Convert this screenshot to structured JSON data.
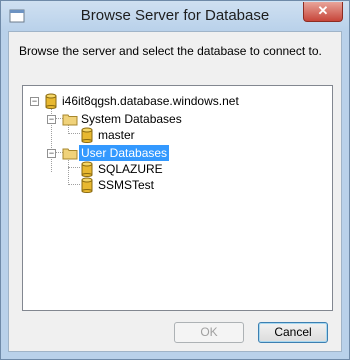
{
  "window": {
    "title": "Browse Server for Database",
    "close_glyph": "✕"
  },
  "instructions": "Browse the server and select the database to connect to.",
  "tree": {
    "server": {
      "label": "i46it8qgsh.database.windows.net",
      "expander": "−",
      "icon": "database-icon"
    },
    "system_databases": {
      "label": "System Databases",
      "expander": "−",
      "icon": "folder-icon",
      "children": [
        {
          "label": "master",
          "icon": "database-icon"
        }
      ]
    },
    "user_databases": {
      "label": "User Databases",
      "expander": "−",
      "icon": "folder-icon",
      "selected": true,
      "children": [
        {
          "label": "SQLAZURE",
          "icon": "database-icon"
        },
        {
          "label": "SSMSTest",
          "icon": "database-icon"
        }
      ]
    }
  },
  "buttons": {
    "ok": {
      "label": "OK",
      "enabled": false
    },
    "cancel": {
      "label": "Cancel",
      "enabled": true
    }
  },
  "colors": {
    "selection": "#3399ff",
    "frame": "#b9d1ea",
    "close_button": "#c7463a",
    "database_icon": "#e8b830"
  }
}
